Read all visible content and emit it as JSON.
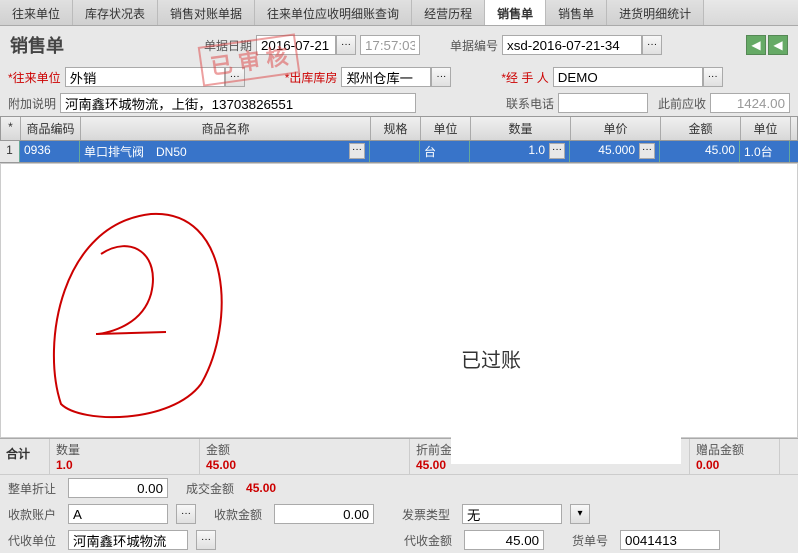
{
  "tabs": [
    "往来单位",
    "库存状况表",
    "销售对账单据",
    "往来单位应收明细账查询",
    "经营历程",
    "销售单",
    "销售单",
    "进货明细统计"
  ],
  "activeTab": 5,
  "title": "销售单",
  "stamp": "已 审 核",
  "header": {
    "docDateLabel": "单据日期",
    "docDate": "2016-07-21",
    "docTime": "17:57:03",
    "docNoLabel": "单据编号",
    "docNo": "xsd-2016-07-21-34"
  },
  "form": {
    "vendorLabel": "往来单位",
    "vendor": "外销",
    "warehouseLabel": "出库库房",
    "warehouse": "郑州仓库一",
    "handlerLabel": "经 手 人",
    "handler": "DEMO",
    "noteLabel": "附加说明",
    "note": "河南鑫环城物流，上街，13703826551",
    "phoneLabel": "联系电话",
    "phone": "",
    "prevRecvLabel": "此前应收",
    "prevRecv": "1424.00"
  },
  "columns": [
    "*",
    "商品编码",
    "商品名称",
    "规格",
    "单位",
    "数量",
    "单价",
    "金额",
    "单位"
  ],
  "row": {
    "idx": "1",
    "code": "0936",
    "name": "单口排气阀　DN50",
    "spec": "",
    "unit": "台",
    "qty": "1.0",
    "price": "45.000",
    "amount": "45.00",
    "unit2": "1.0台"
  },
  "annotation": "已过账",
  "sum": {
    "label": "合计",
    "qtyLabel": "数量",
    "qty": "1.0",
    "amtLabel": "金额",
    "amt": "45.00",
    "preAmtLabel": "折前金额",
    "preAmt": "45.00",
    "giftLabel": "赠品金额",
    "gift": "0.00"
  },
  "foot": {
    "discountLabel": "整单折让",
    "discount": "0.00",
    "dealAmtLabel": "成交金额",
    "dealAmt": "45.00",
    "recvAcctLabel": "收款账户",
    "recvAcct": "A",
    "recvAmtLabel": "收款金额",
    "recvAmt": "0.00",
    "invoiceLabel": "发票类型",
    "invoice": "无",
    "agentVendorLabel": "代收单位",
    "agentVendor": "河南鑫环城物流",
    "agentAmtLabel": "代收金额",
    "agentAmt": "45.00",
    "cargoNoLabel": "货单号",
    "cargoNo": "0041413"
  }
}
